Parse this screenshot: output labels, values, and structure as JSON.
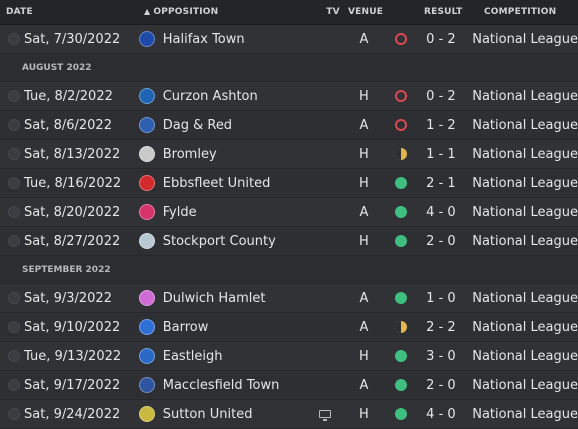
{
  "headers": {
    "date": "DATE",
    "opposition": "OPPOSITION",
    "tv": "TV",
    "venue": "VENUE",
    "result": "RESULT",
    "competition": "COMPETITION"
  },
  "colors": {
    "win": "#3fbf7f",
    "draw": "#e2b64a",
    "loss": "#d94a52"
  },
  "groups": [
    {
      "section": "",
      "rows": [
        {
          "date": "Sat, 7/30/2022",
          "opponent": "Halifax Town",
          "badge": "#1f4aa8",
          "tv": false,
          "venue": "A",
          "outcome": "loss",
          "result": "0 - 2",
          "competition": "National League"
        }
      ]
    },
    {
      "section": "AUGUST 2022",
      "rows": [
        {
          "date": "Tue, 8/2/2022",
          "opponent": "Curzon Ashton",
          "badge": "#1e66b5",
          "tv": false,
          "venue": "H",
          "outcome": "loss",
          "result": "0 - 2",
          "competition": "National League"
        },
        {
          "date": "Sat, 8/6/2022",
          "opponent": "Dag & Red",
          "badge": "#2f5fb0",
          "tv": false,
          "venue": "A",
          "outcome": "loss",
          "result": "1 - 2",
          "competition": "National League"
        },
        {
          "date": "Sat, 8/13/2022",
          "opponent": "Bromley",
          "badge": "#c9c9c9",
          "tv": false,
          "venue": "H",
          "outcome": "draw",
          "result": "1 - 1",
          "competition": "National League"
        },
        {
          "date": "Tue, 8/16/2022",
          "opponent": "Ebbsfleet United",
          "badge": "#d12b2b",
          "tv": false,
          "venue": "H",
          "outcome": "win",
          "result": "2 - 1",
          "competition": "National League"
        },
        {
          "date": "Sat, 8/20/2022",
          "opponent": "Fylde",
          "badge": "#d8346c",
          "tv": false,
          "venue": "A",
          "outcome": "win",
          "result": "4 - 0",
          "competition": "National League"
        },
        {
          "date": "Sat, 8/27/2022",
          "opponent": "Stockport County",
          "badge": "#b8c7d1",
          "tv": false,
          "venue": "H",
          "outcome": "win",
          "result": "2 - 0",
          "competition": "National League"
        }
      ]
    },
    {
      "section": "SEPTEMBER 2022",
      "rows": [
        {
          "date": "Sat, 9/3/2022",
          "opponent": "Dulwich Hamlet",
          "badge": "#d06bd6",
          "tv": false,
          "venue": "A",
          "outcome": "win",
          "result": "1 - 0",
          "competition": "National League"
        },
        {
          "date": "Sat, 9/10/2022",
          "opponent": "Barrow",
          "badge": "#2f6fd6",
          "tv": false,
          "venue": "A",
          "outcome": "draw",
          "result": "2 - 2",
          "competition": "National League"
        },
        {
          "date": "Tue, 9/13/2022",
          "opponent": "Eastleigh",
          "badge": "#2b69c7",
          "tv": false,
          "venue": "H",
          "outcome": "win",
          "result": "3 - 0",
          "competition": "National League"
        },
        {
          "date": "Sat, 9/17/2022",
          "opponent": "Macclesfield Town",
          "badge": "#2f54a0",
          "tv": false,
          "venue": "A",
          "outcome": "win",
          "result": "2 - 0",
          "competition": "National League"
        },
        {
          "date": "Sat, 9/24/2022",
          "opponent": "Sutton United",
          "badge": "#c9b93f",
          "tv": true,
          "venue": "H",
          "outcome": "win",
          "result": "4 - 0",
          "competition": "National League"
        }
      ]
    }
  ]
}
